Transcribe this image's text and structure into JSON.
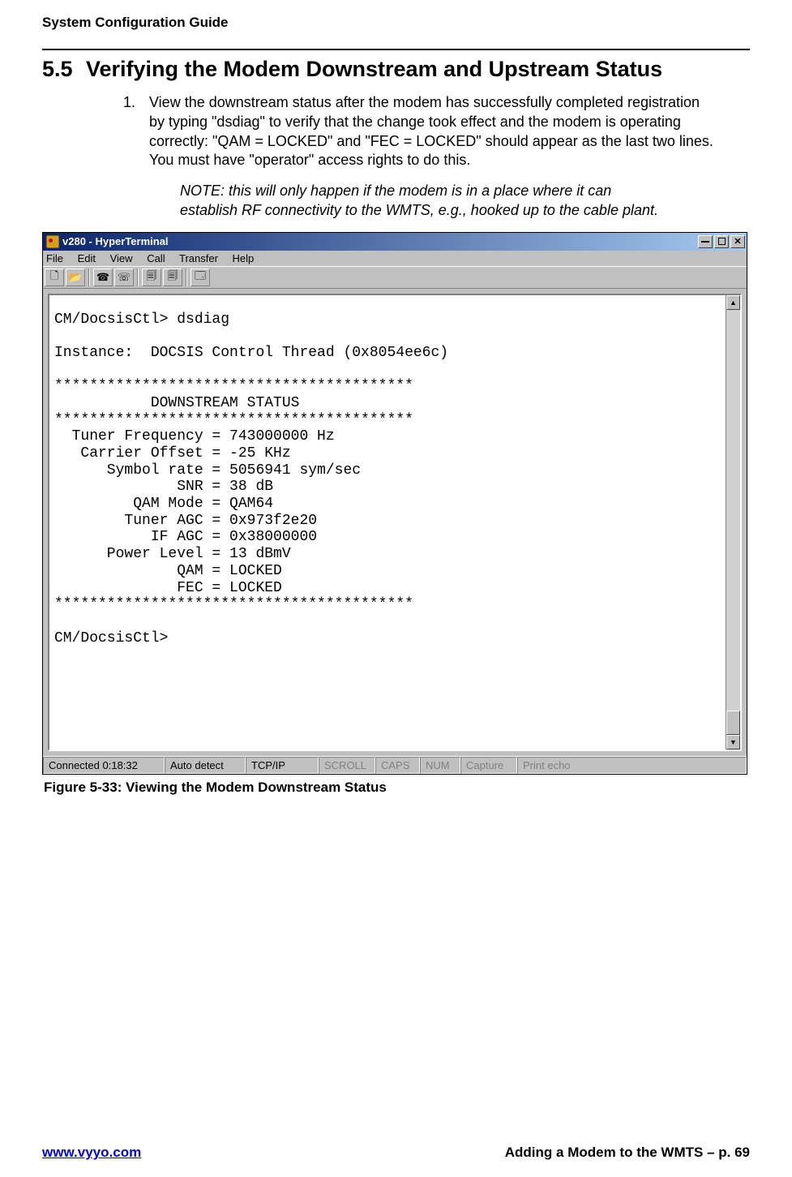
{
  "header": {
    "doc_title": "System Configuration Guide"
  },
  "section": {
    "number": "5.5",
    "title": "Verifying the Modem Downstream and Upstream Status"
  },
  "step1": {
    "marker": "1.",
    "text": "View the downstream status after the modem has successfully completed registration by typing \"dsdiag\" to verify that the change took effect and the modem is operating correctly:  \"QAM = LOCKED\" and \"FEC = LOCKED\" should appear as the last two lines.  You must have \"operator\" access rights to do this."
  },
  "note": "NOTE:  this will only happen if the modem is in a place where it can establish RF connectivity to the WMTS, e.g., hooked up to the cable plant.",
  "window": {
    "title": "v280 - HyperTerminal",
    "menu": [
      "File",
      "Edit",
      "View",
      "Call",
      "Transfer",
      "Help"
    ],
    "toolbar_icons": [
      "new-file-icon",
      "open-file-icon",
      "phone-connect-icon",
      "phone-disconnect-icon",
      "send-icon",
      "receive-icon",
      "properties-icon"
    ]
  },
  "terminal_text": "CM/DocsisCtl> dsdiag\n\nInstance:  DOCSIS Control Thread (0x8054ee6c)\n\n*****************************************\n           DOWNSTREAM STATUS            \n*****************************************\n  Tuner Frequency = 743000000 Hz\n   Carrier Offset = -25 KHz\n      Symbol rate = 5056941 sym/sec\n              SNR = 38 dB\n         QAM Mode = QAM64\n        Tuner AGC = 0x973f2e20\n           IF AGC = 0x38000000\n      Power Level = 13 dBmV\n              QAM = LOCKED\n              FEC = LOCKED\n*****************************************\n\nCM/DocsisCtl>",
  "statusbar": {
    "connected": "Connected 0:18:32",
    "detect": "Auto detect",
    "protocol": "TCP/IP",
    "indicators": [
      "SCROLL",
      "CAPS",
      "NUM",
      "Capture",
      "Print echo"
    ]
  },
  "figure_caption": "Figure 5-33: Viewing the Modem Downstream Status",
  "footer": {
    "url": "www.vyyo.com",
    "right": "Adding a Modem to the WMTS – p. 69"
  }
}
